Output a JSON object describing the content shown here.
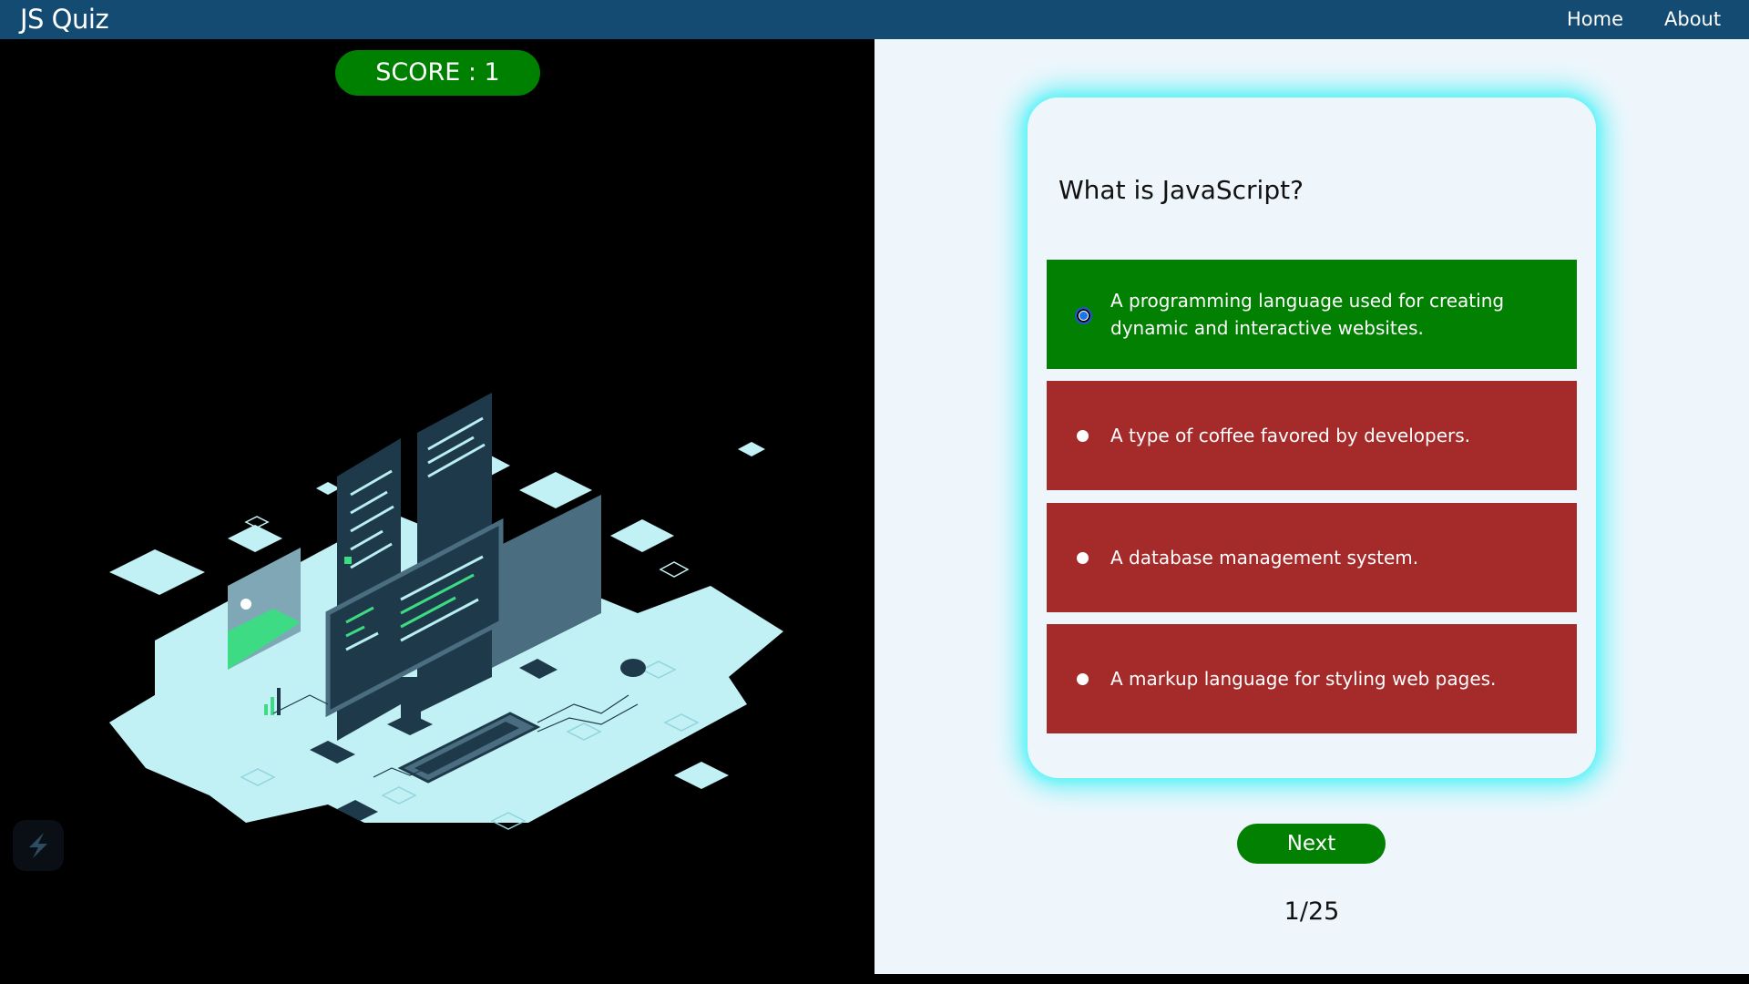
{
  "app": {
    "title": "JS Quiz",
    "nav": [
      {
        "label": "Home"
      },
      {
        "label": "About"
      }
    ]
  },
  "score": {
    "label": "SCORE : 1"
  },
  "quiz": {
    "question": "What is JavaScript?",
    "options": [
      {
        "text": "A programming language used for creating dynamic and interactive websites.",
        "state": "correct",
        "selected": true
      },
      {
        "text": "A type of coffee favored by developers.",
        "state": "wrong",
        "selected": false
      },
      {
        "text": "A database management system.",
        "state": "wrong",
        "selected": false
      },
      {
        "text": "A markup language for styling web pages.",
        "state": "wrong",
        "selected": false
      }
    ],
    "next_label": "Next",
    "progress": "1/25"
  },
  "colors": {
    "navbar": "#134b73",
    "correct": "#018001",
    "wrong": "#a52a2a",
    "card_glow": "#5ff2f6",
    "panel_bg": "#eef6fc"
  },
  "icons": {
    "illustration": "isometric-computer-workspace-illustration",
    "corner_logo": "app-logo-icon"
  }
}
